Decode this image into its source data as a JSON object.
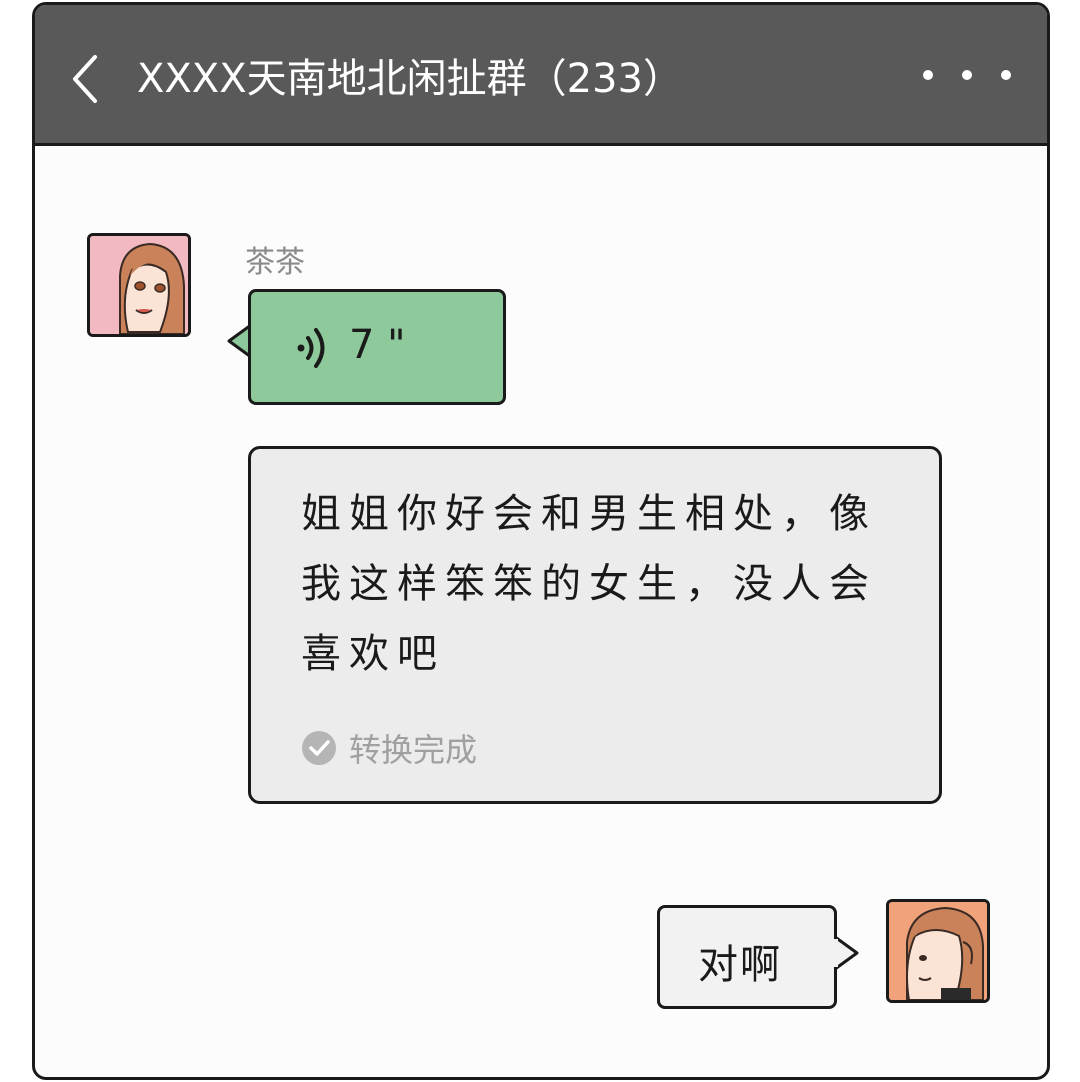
{
  "header": {
    "title": "XXXX天南地北闲扯群（233）",
    "back_icon": "chevron-left-icon",
    "more_icon": "more-dots-icon"
  },
  "messages": [
    {
      "sender": "茶茶",
      "type": "voice",
      "duration": "7 \"",
      "icon": "voice-wave-icon",
      "bubble_color": "#8ec99b"
    },
    {
      "type": "voice-to-text",
      "text": "姐姐你好会和男生相处，像我这样笨笨的女生，没人会喜欢吧",
      "status": "转换完成",
      "status_icon": "check-circle-icon"
    },
    {
      "sender": "self",
      "type": "text",
      "text": "对啊"
    }
  ],
  "colors": {
    "header_bg": "#595959",
    "voice_bubble": "#8ec99b",
    "text_bubble": "#ececec",
    "self_bubble": "#f2f2f2"
  }
}
